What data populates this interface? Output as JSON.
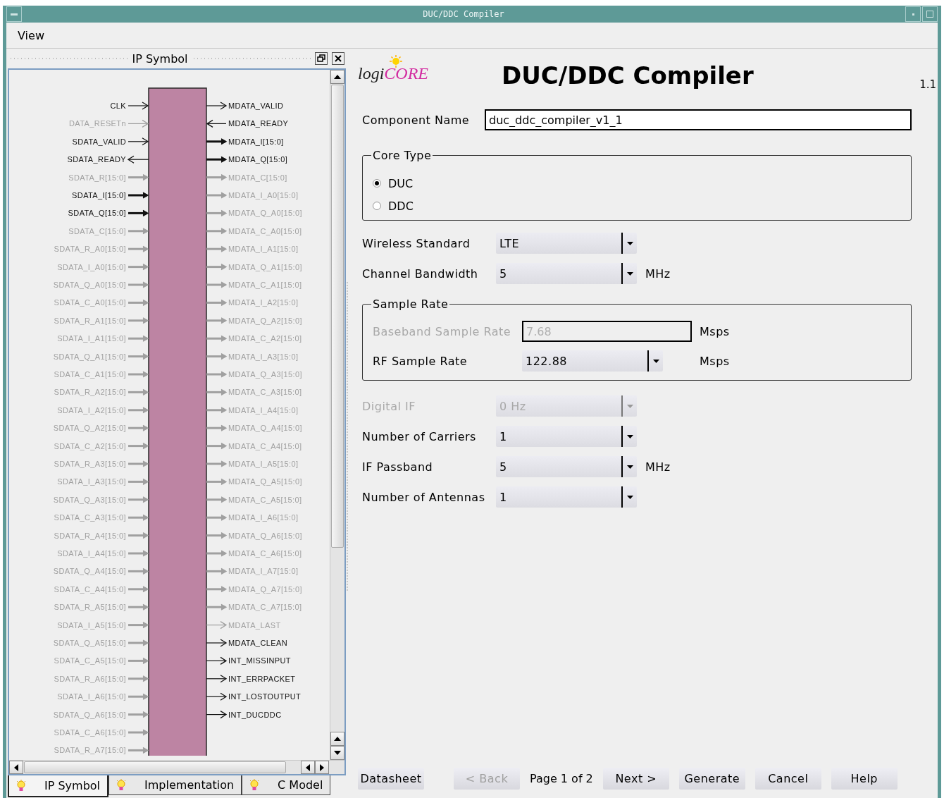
{
  "window": {
    "title": "DUC/DDC Compiler"
  },
  "menu": [
    "View"
  ],
  "symbol_panel": {
    "title": "IP Symbol",
    "inputs": [
      {
        "name": "CLK",
        "outgoing": false,
        "bus": false,
        "enabled": true
      },
      {
        "name": "DATA_RESETn",
        "outgoing": false,
        "bus": false,
        "enabled": false
      },
      {
        "name": "SDATA_VALID",
        "outgoing": false,
        "bus": false,
        "enabled": true
      },
      {
        "name": "SDATA_READY",
        "outgoing": true,
        "bus": false,
        "enabled": true
      },
      {
        "name": "SDATA_R[15:0]",
        "outgoing": false,
        "bus": true,
        "enabled": false
      },
      {
        "name": "SDATA_I[15:0]",
        "outgoing": false,
        "bus": true,
        "enabled": true
      },
      {
        "name": "SDATA_Q[15:0]",
        "outgoing": false,
        "bus": true,
        "enabled": true
      },
      {
        "name": "SDATA_C[15:0]",
        "outgoing": false,
        "bus": true,
        "enabled": false
      },
      {
        "name": "SDATA_R_A0[15:0]",
        "outgoing": false,
        "bus": true,
        "enabled": false
      },
      {
        "name": "SDATA_I_A0[15:0]",
        "outgoing": false,
        "bus": true,
        "enabled": false
      },
      {
        "name": "SDATA_Q_A0[15:0]",
        "outgoing": false,
        "bus": true,
        "enabled": false
      },
      {
        "name": "SDATA_C_A0[15:0]",
        "outgoing": false,
        "bus": true,
        "enabled": false
      },
      {
        "name": "SDATA_R_A1[15:0]",
        "outgoing": false,
        "bus": true,
        "enabled": false
      },
      {
        "name": "SDATA_I_A1[15:0]",
        "outgoing": false,
        "bus": true,
        "enabled": false
      },
      {
        "name": "SDATA_Q_A1[15:0]",
        "outgoing": false,
        "bus": true,
        "enabled": false
      },
      {
        "name": "SDATA_C_A1[15:0]",
        "outgoing": false,
        "bus": true,
        "enabled": false
      },
      {
        "name": "SDATA_R_A2[15:0]",
        "outgoing": false,
        "bus": true,
        "enabled": false
      },
      {
        "name": "SDATA_I_A2[15:0]",
        "outgoing": false,
        "bus": true,
        "enabled": false
      },
      {
        "name": "SDATA_Q_A2[15:0]",
        "outgoing": false,
        "bus": true,
        "enabled": false
      },
      {
        "name": "SDATA_C_A2[15:0]",
        "outgoing": false,
        "bus": true,
        "enabled": false
      },
      {
        "name": "SDATA_R_A3[15:0]",
        "outgoing": false,
        "bus": true,
        "enabled": false
      },
      {
        "name": "SDATA_I_A3[15:0]",
        "outgoing": false,
        "bus": true,
        "enabled": false
      },
      {
        "name": "SDATA_Q_A3[15:0]",
        "outgoing": false,
        "bus": true,
        "enabled": false
      },
      {
        "name": "SDATA_C_A3[15:0]",
        "outgoing": false,
        "bus": true,
        "enabled": false
      },
      {
        "name": "SDATA_R_A4[15:0]",
        "outgoing": false,
        "bus": true,
        "enabled": false
      },
      {
        "name": "SDATA_I_A4[15:0]",
        "outgoing": false,
        "bus": true,
        "enabled": false
      },
      {
        "name": "SDATA_Q_A4[15:0]",
        "outgoing": false,
        "bus": true,
        "enabled": false
      },
      {
        "name": "SDATA_C_A4[15:0]",
        "outgoing": false,
        "bus": true,
        "enabled": false
      },
      {
        "name": "SDATA_R_A5[15:0]",
        "outgoing": false,
        "bus": true,
        "enabled": false
      },
      {
        "name": "SDATA_I_A5[15:0]",
        "outgoing": false,
        "bus": true,
        "enabled": false
      },
      {
        "name": "SDATA_Q_A5[15:0]",
        "outgoing": false,
        "bus": true,
        "enabled": false
      },
      {
        "name": "SDATA_C_A5[15:0]",
        "outgoing": false,
        "bus": true,
        "enabled": false
      },
      {
        "name": "SDATA_R_A6[15:0]",
        "outgoing": false,
        "bus": true,
        "enabled": false
      },
      {
        "name": "SDATA_I_A6[15:0]",
        "outgoing": false,
        "bus": true,
        "enabled": false
      },
      {
        "name": "SDATA_Q_A6[15:0]",
        "outgoing": false,
        "bus": true,
        "enabled": false
      },
      {
        "name": "SDATA_C_A6[15:0]",
        "outgoing": false,
        "bus": true,
        "enabled": false
      },
      {
        "name": "SDATA_R_A7[15:0]",
        "outgoing": false,
        "bus": true,
        "enabled": false
      }
    ],
    "outputs": [
      {
        "name": "MDATA_VALID",
        "outgoing": true,
        "bus": false,
        "enabled": true
      },
      {
        "name": "MDATA_READY",
        "outgoing": false,
        "bus": false,
        "enabled": true
      },
      {
        "name": "MDATA_I[15:0]",
        "outgoing": true,
        "bus": true,
        "enabled": true
      },
      {
        "name": "MDATA_Q[15:0]",
        "outgoing": true,
        "bus": true,
        "enabled": true
      },
      {
        "name": "MDATA_C[15:0]",
        "outgoing": true,
        "bus": true,
        "enabled": false
      },
      {
        "name": "MDATA_I_A0[15:0]",
        "outgoing": true,
        "bus": true,
        "enabled": false
      },
      {
        "name": "MDATA_Q_A0[15:0]",
        "outgoing": true,
        "bus": true,
        "enabled": false
      },
      {
        "name": "MDATA_C_A0[15:0]",
        "outgoing": true,
        "bus": true,
        "enabled": false
      },
      {
        "name": "MDATA_I_A1[15:0]",
        "outgoing": true,
        "bus": true,
        "enabled": false
      },
      {
        "name": "MDATA_Q_A1[15:0]",
        "outgoing": true,
        "bus": true,
        "enabled": false
      },
      {
        "name": "MDATA_C_A1[15:0]",
        "outgoing": true,
        "bus": true,
        "enabled": false
      },
      {
        "name": "MDATA_I_A2[15:0]",
        "outgoing": true,
        "bus": true,
        "enabled": false
      },
      {
        "name": "MDATA_Q_A2[15:0]",
        "outgoing": true,
        "bus": true,
        "enabled": false
      },
      {
        "name": "MDATA_C_A2[15:0]",
        "outgoing": true,
        "bus": true,
        "enabled": false
      },
      {
        "name": "MDATA_I_A3[15:0]",
        "outgoing": true,
        "bus": true,
        "enabled": false
      },
      {
        "name": "MDATA_Q_A3[15:0]",
        "outgoing": true,
        "bus": true,
        "enabled": false
      },
      {
        "name": "MDATA_C_A3[15:0]",
        "outgoing": true,
        "bus": true,
        "enabled": false
      },
      {
        "name": "MDATA_I_A4[15:0]",
        "outgoing": true,
        "bus": true,
        "enabled": false
      },
      {
        "name": "MDATA_Q_A4[15:0]",
        "outgoing": true,
        "bus": true,
        "enabled": false
      },
      {
        "name": "MDATA_C_A4[15:0]",
        "outgoing": true,
        "bus": true,
        "enabled": false
      },
      {
        "name": "MDATA_I_A5[15:0]",
        "outgoing": true,
        "bus": true,
        "enabled": false
      },
      {
        "name": "MDATA_Q_A5[15:0]",
        "outgoing": true,
        "bus": true,
        "enabled": false
      },
      {
        "name": "MDATA_C_A5[15:0]",
        "outgoing": true,
        "bus": true,
        "enabled": false
      },
      {
        "name": "MDATA_I_A6[15:0]",
        "outgoing": true,
        "bus": true,
        "enabled": false
      },
      {
        "name": "MDATA_Q_A6[15:0]",
        "outgoing": true,
        "bus": true,
        "enabled": false
      },
      {
        "name": "MDATA_C_A6[15:0]",
        "outgoing": true,
        "bus": true,
        "enabled": false
      },
      {
        "name": "MDATA_I_A7[15:0]",
        "outgoing": true,
        "bus": true,
        "enabled": false
      },
      {
        "name": "MDATA_Q_A7[15:0]",
        "outgoing": true,
        "bus": true,
        "enabled": false
      },
      {
        "name": "MDATA_C_A7[15:0]",
        "outgoing": true,
        "bus": true,
        "enabled": false
      },
      {
        "name": "MDATA_LAST",
        "outgoing": true,
        "bus": false,
        "enabled": false
      },
      {
        "name": "MDATA_CLEAN",
        "outgoing": true,
        "bus": false,
        "enabled": true
      },
      {
        "name": "INT_MISSINPUT",
        "outgoing": true,
        "bus": false,
        "enabled": true
      },
      {
        "name": "INT_ERRPACKET",
        "outgoing": true,
        "bus": false,
        "enabled": true
      },
      {
        "name": "INT_LOSTOUTPUT",
        "outgoing": true,
        "bus": false,
        "enabled": true
      },
      {
        "name": "INT_DUCDDC",
        "outgoing": true,
        "bus": false,
        "enabled": true
      }
    ]
  },
  "bottom_tabs": [
    {
      "label": "IP Symbol",
      "selected": true
    },
    {
      "label": "Implementation",
      "selected": false
    },
    {
      "label": "C Model",
      "selected": false
    }
  ],
  "header": {
    "logo_prefix": "logi",
    "logo_suffix": "CORE",
    "title": "DUC/DDC Compiler",
    "version": "1.1"
  },
  "form": [
    {
      "kind": "text",
      "label": "Component Name",
      "value": "duc_ddc_compiler_v1_1",
      "disabled": false
    },
    {
      "kind": "radio_group",
      "title": "Core Type",
      "options": [
        {
          "label": "DUC",
          "selected": true
        },
        {
          "label": "DDC",
          "selected": false
        }
      ]
    },
    {
      "kind": "combo",
      "label": "Wireless Standard",
      "value": "LTE",
      "disabled": false
    },
    {
      "kind": "combo",
      "label": "Channel Bandwidth",
      "value": "5",
      "unit": "MHz",
      "disabled": false
    },
    {
      "kind": "group",
      "title": "Sample Rate",
      "fields": [
        {
          "kind": "text",
          "label": "Baseband Sample Rate",
          "value": "7.68",
          "unit": "Msps",
          "disabled": true
        },
        {
          "kind": "combo",
          "label": "RF Sample Rate",
          "value": "122.88",
          "unit": "Msps",
          "disabled": false
        }
      ]
    },
    {
      "kind": "combo",
      "label": "Digital IF",
      "value": "0 Hz",
      "disabled": true
    },
    {
      "kind": "combo",
      "label": "Number of Carriers",
      "value": "1",
      "disabled": false
    },
    {
      "kind": "combo",
      "label": "IF Passband",
      "value": "5",
      "unit": "MHz",
      "disabled": false
    },
    {
      "kind": "combo",
      "label": "Number of Antennas",
      "value": "1",
      "disabled": false
    }
  ],
  "footer": [
    {
      "kind": "button",
      "label": "Datasheet",
      "disabled": false
    },
    {
      "kind": "button",
      "label": "< Back",
      "disabled": true
    },
    {
      "kind": "text",
      "label": "Page 1 of 2"
    },
    {
      "kind": "button",
      "label": "Next >",
      "disabled": false
    },
    {
      "kind": "button",
      "label": "Generate",
      "disabled": false
    },
    {
      "kind": "button",
      "label": "Cancel",
      "disabled": false
    },
    {
      "kind": "button",
      "label": "Help",
      "disabled": false
    }
  ]
}
